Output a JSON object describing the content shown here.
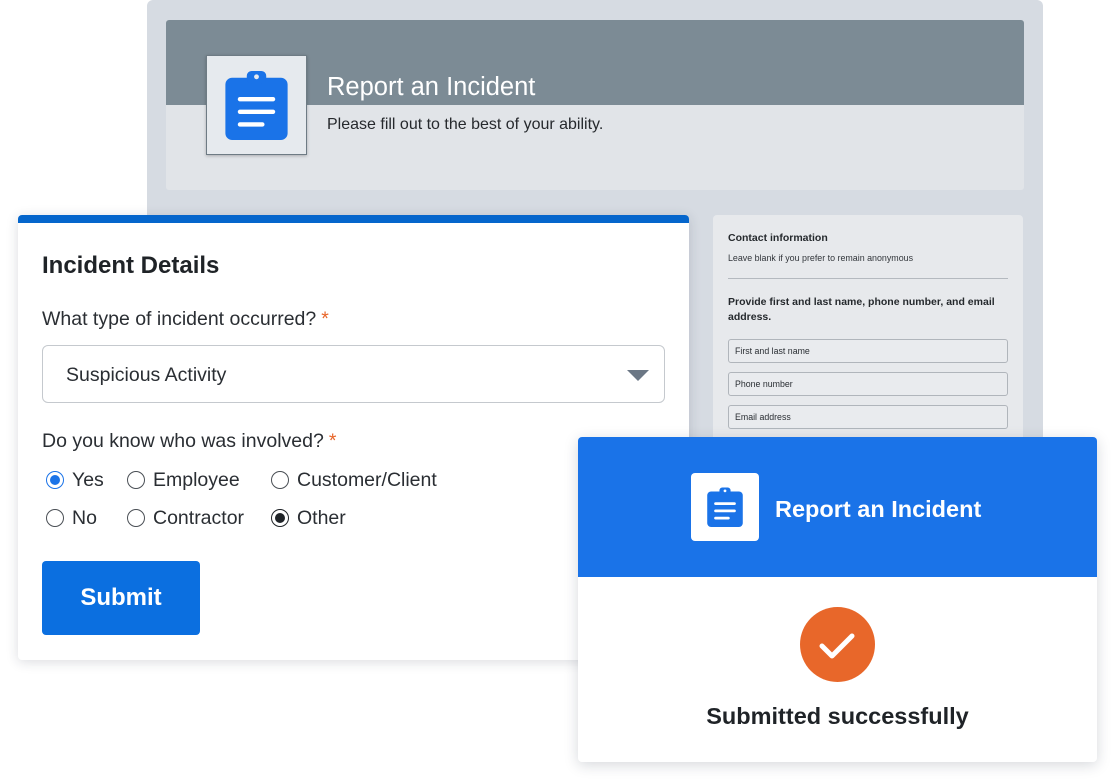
{
  "background_form": {
    "icon": "clipboard-icon",
    "title": "Report an Incident",
    "subtitle": "Please fill out to the best of your ability.",
    "contact": {
      "heading": "Contact information",
      "hint": "Leave blank if you prefer to remain anonymous",
      "prompt": "Provide first and last name, phone number, and email address.",
      "fields": [
        "First and last name",
        "Phone number",
        "Email address"
      ]
    }
  },
  "incident_card": {
    "heading": "Incident Details",
    "required_mark": "*",
    "incident_type": {
      "label": "What type of incident occurred?",
      "value": "Suspicious Activity",
      "caret_icon": "caret-down-icon"
    },
    "involved": {
      "label": "Do you know who was involved?",
      "options": [
        {
          "label": "Yes",
          "checked": true
        },
        {
          "label": "Employee",
          "checked": false
        },
        {
          "label": "Customer/Client",
          "checked": false
        },
        {
          "label": "No",
          "checked": false
        },
        {
          "label": "Contractor",
          "checked": false
        },
        {
          "label": "Other",
          "checked": true
        }
      ]
    },
    "submit_label": "Submit"
  },
  "confirmation": {
    "icon": "clipboard-icon",
    "title": "Report an Incident",
    "status_icon": "checkmark-icon",
    "message": "Submitted successfully"
  },
  "colors": {
    "brand_blue": "#1a73e8",
    "card_accent": "#0566cc",
    "button_blue": "#0b6fe0",
    "required_orange": "#e8662a",
    "success_orange": "#e8672a",
    "header_gray": "#7c8b95"
  }
}
